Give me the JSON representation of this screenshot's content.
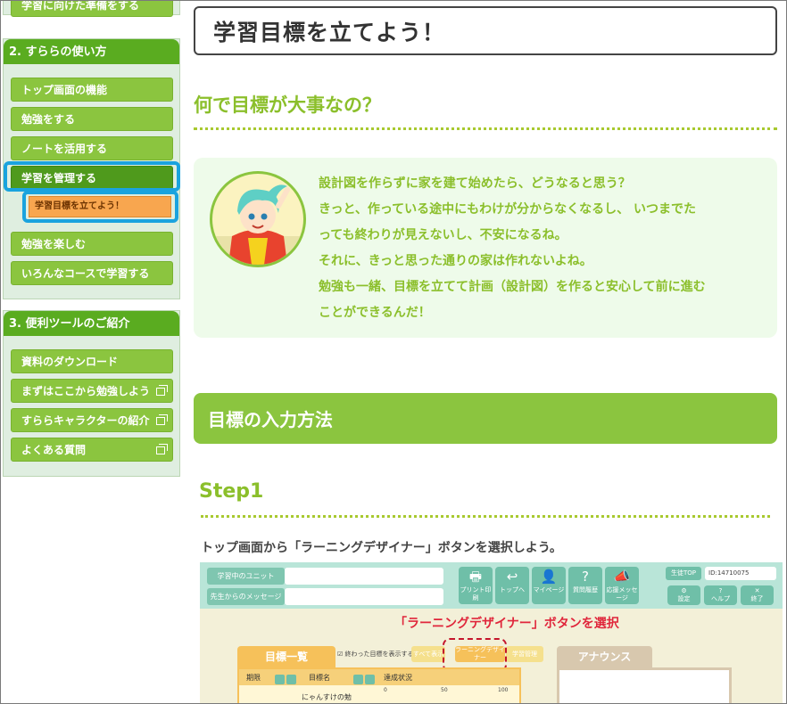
{
  "sidebar": {
    "prev_item_label": "学習に向けた準備をする",
    "section2": {
      "heading": "2. すららの使い方",
      "items": [
        "トップ画面の機能",
        "勉強をする",
        "ノートを活用する",
        "学習を管理する"
      ],
      "sub_item": "学習目標を立てよう！",
      "items_after": [
        "勉強を楽しむ",
        "いろんなコースで学習する"
      ]
    },
    "section3": {
      "heading": "3. 便利ツールのご紹介",
      "items": [
        "資料のダウンロード",
        "まずはここから勉強しよう",
        "すららキャラクターの紹介",
        "よくある質問"
      ]
    },
    "colors": {
      "header": "#5aac20",
      "button": "#8bc53f",
      "highlight": "#1aa3de",
      "sub_item": "#f8a64f"
    }
  },
  "main": {
    "page_title": "学習目標を立てよう！",
    "why_heading": "何で目標が大事なの？",
    "speech_lines": [
      "設計図を作らずに家を建て始めたら、どうなると思う？",
      "きっと、作っている途中にもわけが分からなくなるし、 いつまでた",
      "っても終わりが見えないし、不安になるね。",
      "それに、きっと思った通りの家は作れないよね。",
      "勉強も一緒、目標を立てて計画（設計図）を作ると安心して前に進む",
      "ことができるんだ！"
    ],
    "avatar_icon": "character-avatar",
    "method_heading": "目標の入力方法",
    "step_heading": "Step1",
    "step_description": "トップ画面から「ラーニングデザイナー」ボタンを選択しよう。",
    "colors": {
      "accent": "#8bbf2b",
      "band": "#8bc53f",
      "speech_bg": "#eefbea"
    }
  },
  "screenshot": {
    "unit_label": "学習中のユニット",
    "message_label": "先生からのメッセージ",
    "buttons": [
      {
        "glyph": "🖶",
        "label": "プリント印刷"
      },
      {
        "glyph": "↩",
        "label": "トップへ"
      },
      {
        "glyph": "👤",
        "label": "マイページ"
      },
      {
        "glyph": "?",
        "label": "質問履歴"
      },
      {
        "glyph": "📣",
        "label": "応援メッセージ"
      }
    ],
    "student_top": "生徒TOP",
    "student_id": "ID:14710075",
    "small_buttons": [
      "設定",
      "ヘルプ",
      "終了"
    ],
    "callout": "「ラーニングデザイナー」ボタンを選択",
    "goal_list_tab": "目標一覧",
    "show_finished": "終わった目標を表示する",
    "btn_all": "すべて表示",
    "btn_learning_designer": "ラーニングデザイナー",
    "btn_history": "学習管理",
    "announce_tab": "アナウンス",
    "col_period": "期限",
    "col_goal": "目標名",
    "col_status": "達成状況",
    "ticks": [
      "0",
      "50",
      "100"
    ],
    "row_goal": "にゃんすけの勉"
  }
}
